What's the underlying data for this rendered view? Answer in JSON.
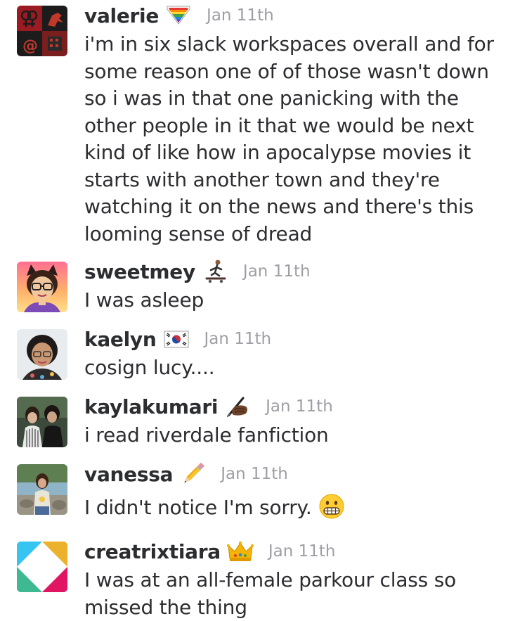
{
  "messages": [
    {
      "username": "valerie",
      "emoji": "rainbow-heart-shield-emoji",
      "timestamp": "Jan 11th",
      "lines": [
        "i'm in six slack workspaces overall and for",
        "some reason one of of those wasn't down",
        "so i was in that one panicking with the",
        "other people in it that we would be next",
        "kind of like how in apocalypse movies it",
        "starts with another town and they're",
        "watching it on the news and there's this",
        "looming sense of dread"
      ]
    },
    {
      "username": "sweetmey",
      "emoji": "skateboarder-emoji",
      "timestamp": "Jan 11th",
      "lines": [
        "I was asleep"
      ]
    },
    {
      "username": "kaelyn",
      "emoji": "south-korea-flag-emoji",
      "timestamp": "Jan 11th",
      "lines": [
        "cosign lucy...."
      ]
    },
    {
      "username": "kaylakumari",
      "emoji": "writing-hand-emoji",
      "timestamp": "Jan 11th",
      "lines": [
        "i read riverdale fanfiction"
      ]
    },
    {
      "username": "vanessa",
      "emoji": "pencil-emoji",
      "timestamp": "Jan 11th",
      "lines": [
        "I didn't notice I'm sorry."
      ],
      "trailing_emoji": "grimacing-face-emoji"
    },
    {
      "username": "creatrixtiara",
      "emoji": "crown-emoji",
      "timestamp": "Jan 11th",
      "lines": [
        "I was at an all-female parkour class so",
        "missed the thing"
      ]
    }
  ]
}
